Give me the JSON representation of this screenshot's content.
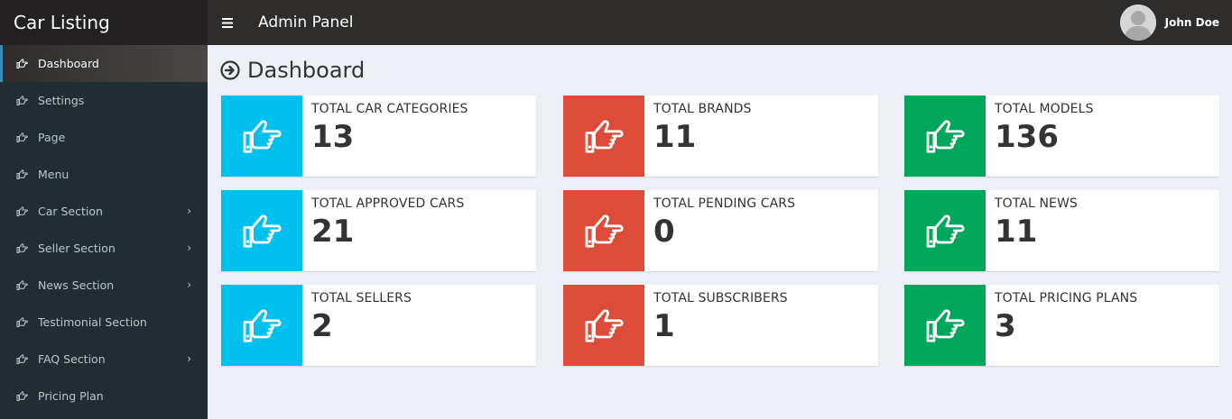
{
  "header": {
    "brand": "Car Listing",
    "menu_icon": "hamburger-icon",
    "title": "Admin Panel",
    "user_name": "John Doe",
    "avatar_icon": "user-avatar-icon"
  },
  "sidebar": {
    "items": [
      {
        "label": "Dashboard",
        "icon": "hand-point-right-icon",
        "active": true,
        "has_children": false
      },
      {
        "label": "Settings",
        "icon": "hand-point-right-icon",
        "active": false,
        "has_children": false
      },
      {
        "label": "Page",
        "icon": "hand-point-right-icon",
        "active": false,
        "has_children": false
      },
      {
        "label": "Menu",
        "icon": "hand-point-right-icon",
        "active": false,
        "has_children": false
      },
      {
        "label": "Car Section",
        "icon": "hand-point-right-icon",
        "active": false,
        "has_children": true
      },
      {
        "label": "Seller Section",
        "icon": "hand-point-right-icon",
        "active": false,
        "has_children": true
      },
      {
        "label": "News Section",
        "icon": "hand-point-right-icon",
        "active": false,
        "has_children": true
      },
      {
        "label": "Testimonial Section",
        "icon": "hand-point-right-icon",
        "active": false,
        "has_children": false
      },
      {
        "label": "FAQ Section",
        "icon": "hand-point-right-icon",
        "active": false,
        "has_children": true
      },
      {
        "label": "Pricing Plan",
        "icon": "hand-point-right-icon",
        "active": false,
        "has_children": false
      }
    ]
  },
  "page": {
    "title": "Dashboard",
    "title_icon": "arrow-circle-right-icon"
  },
  "colors": {
    "blue": "#00c0ef",
    "red": "#dd4b39",
    "green": "#00a65a",
    "sidebar": "#222d32",
    "header": "#2f2d2c"
  },
  "cards": [
    {
      "label": "TOTAL CAR CATEGORIES",
      "value": "13",
      "color": "blue"
    },
    {
      "label": "TOTAL BRANDS",
      "value": "11",
      "color": "red"
    },
    {
      "label": "TOTAL MODELS",
      "value": "136",
      "color": "green"
    },
    {
      "label": "TOTAL APPROVED CARS",
      "value": "21",
      "color": "blue"
    },
    {
      "label": "TOTAL PENDING CARS",
      "value": "0",
      "color": "red"
    },
    {
      "label": "TOTAL NEWS",
      "value": "11",
      "color": "green"
    },
    {
      "label": "TOTAL SELLERS",
      "value": "2",
      "color": "blue"
    },
    {
      "label": "TOTAL SUBSCRIBERS",
      "value": "1",
      "color": "red"
    },
    {
      "label": "TOTAL PRICING PLANS",
      "value": "3",
      "color": "green"
    }
  ]
}
